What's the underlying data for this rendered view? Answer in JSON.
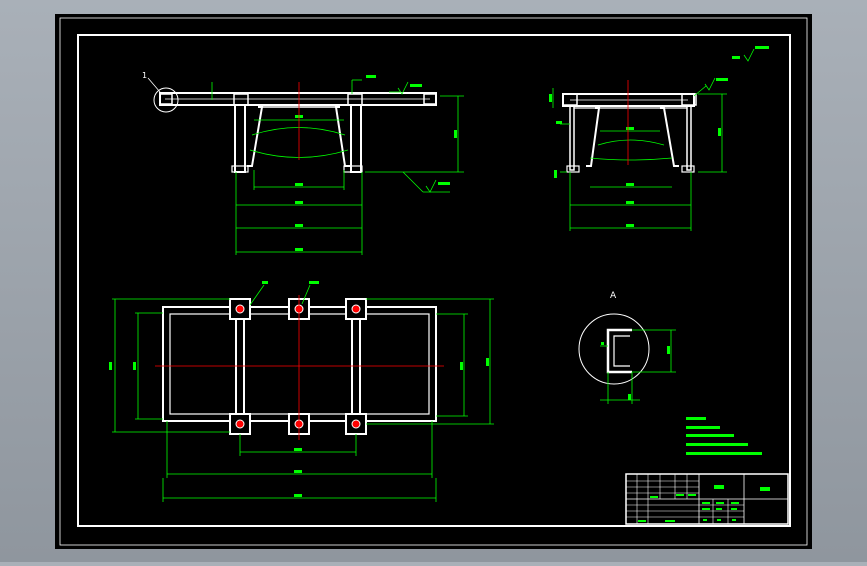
{
  "colors": {
    "frame_bg": "#a3aab2",
    "sheet": "#000000",
    "border": "#ffffff",
    "part": "#ffffff",
    "dimension": "#00ff00",
    "centerline": "#ff0000",
    "leader": "#00ff00"
  },
  "labels": {
    "detail_callout_number": "1",
    "detail_view_letter": "A",
    "roughness_value": "Ra 6.3"
  },
  "icons": {
    "surface_finish": "roughness-symbol-icon",
    "hole_marker": "bolt-hole-icon"
  }
}
